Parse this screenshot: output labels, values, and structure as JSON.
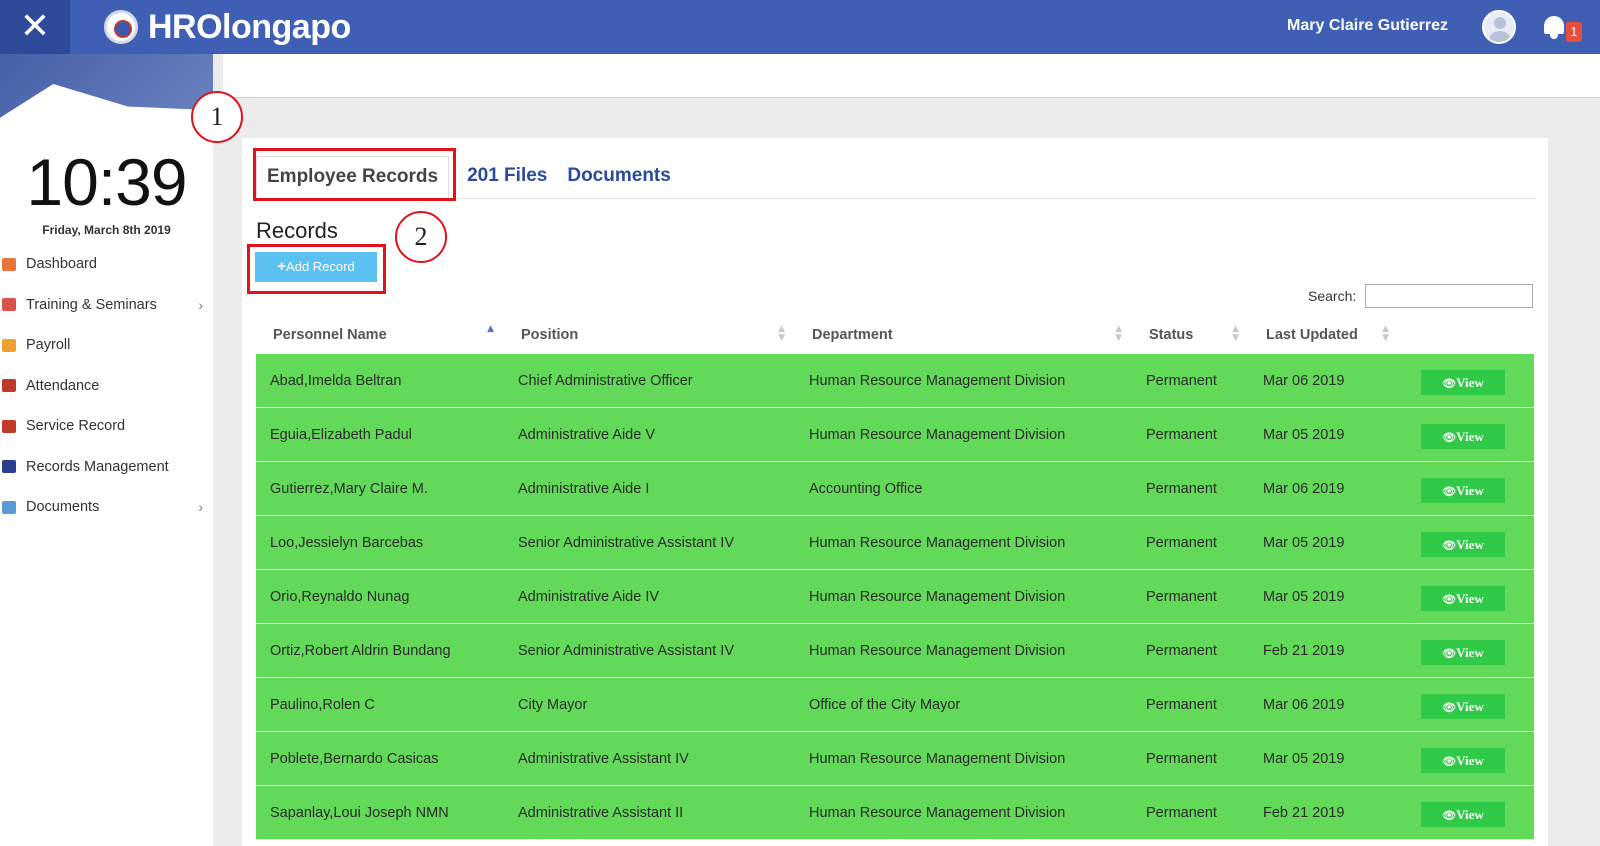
{
  "header": {
    "close_label": "✕",
    "brand": "HROlongapo",
    "user_name": "Mary Claire Gutierrez",
    "notification_count": "1"
  },
  "sidebar": {
    "time": "10:39",
    "date": "Friday, March 8th 2019",
    "items": [
      {
        "label": "Dashboard",
        "icon": "dashboard-icon",
        "color": "#e8743b",
        "has_submenu": false
      },
      {
        "label": "Training & Seminars",
        "icon": "calendar-icon",
        "color": "#d9534f",
        "has_submenu": true
      },
      {
        "label": "Payroll",
        "icon": "people-icon",
        "color": "#f0a030",
        "has_submenu": false
      },
      {
        "label": "Attendance",
        "icon": "clock-icon",
        "color": "#c0392b",
        "has_submenu": false
      },
      {
        "label": "Service Record",
        "icon": "search-icon",
        "color": "#c0392b",
        "has_submenu": false
      },
      {
        "label": "Records Management",
        "icon": "book-icon",
        "color": "#2a3f8f",
        "has_submenu": false
      },
      {
        "label": "Documents",
        "icon": "document-icon",
        "color": "#5b9bd5",
        "has_submenu": true
      }
    ]
  },
  "tabs": [
    "Employee Records",
    "201 Files",
    "Documents"
  ],
  "records": {
    "title": "Records",
    "add_label": "Add Record",
    "search_label": "Search:"
  },
  "table": {
    "columns": [
      "Personnel Name",
      "Position",
      "Department",
      "Status",
      "Last Updated"
    ],
    "view_label": "View",
    "row_color": "#63d95a",
    "rows": [
      [
        "Abad,Imelda Beltran",
        "Chief Administrative Officer",
        "Human Resource Management Division",
        "Permanent",
        "Mar 06 2019"
      ],
      [
        "Eguia,Elizabeth Padul",
        "Administrative Aide V",
        "Human Resource Management Division",
        "Permanent",
        "Mar 05 2019"
      ],
      [
        "Gutierrez,Mary Claire M.",
        "Administrative Aide I",
        "Accounting Office",
        "Permanent",
        "Mar 06 2019"
      ],
      [
        "Loo,Jessielyn Barcebas",
        "Senior Administrative Assistant IV",
        "Human Resource Management Division",
        "Permanent",
        "Mar 05 2019"
      ],
      [
        "Orio,Reynaldo Nunag",
        "Administrative Aide IV",
        "Human Resource Management Division",
        "Permanent",
        "Mar 05 2019"
      ],
      [
        "Ortiz,Robert Aldrin Bundang",
        "Senior Administrative Assistant IV",
        "Human Resource Management Division",
        "Permanent",
        "Feb 21 2019"
      ],
      [
        "Paulino,Rolen C",
        "City Mayor",
        "Office of the City Mayor",
        "Permanent",
        "Mar 06 2019"
      ],
      [
        "Poblete,Bernardo Casicas",
        "Administrative Assistant IV",
        "Human Resource Management Division",
        "Permanent",
        "Mar 05 2019"
      ],
      [
        "Sapanlay,Loui Joseph NMN",
        "Administrative Assistant II",
        "Human Resource Management Division",
        "Permanent",
        "Feb 21 2019"
      ]
    ]
  },
  "annotations": [
    "1",
    "2"
  ]
}
